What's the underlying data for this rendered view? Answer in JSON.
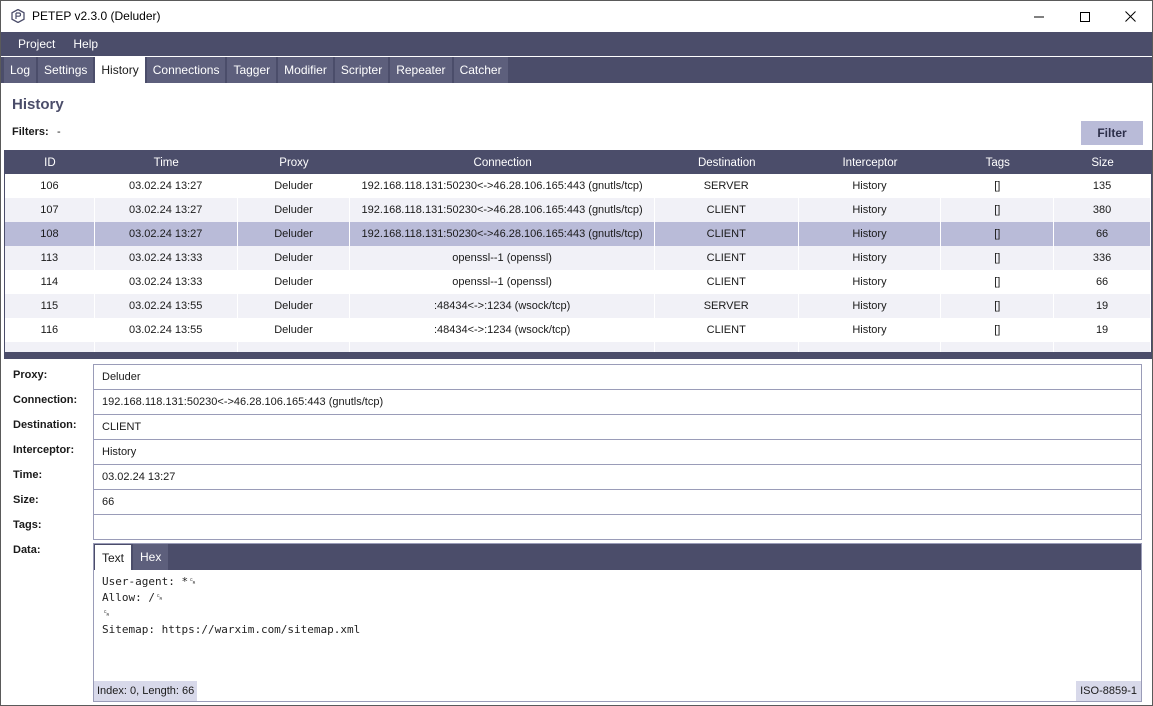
{
  "window": {
    "title": "PETEP v2.3.0 (Deluder)"
  },
  "menu": [
    "Project",
    "Help"
  ],
  "tabs": [
    "Log",
    "Settings",
    "History",
    "Connections",
    "Tagger",
    "Modifier",
    "Scripter",
    "Repeater",
    "Catcher"
  ],
  "active_tab": "History",
  "history": {
    "title": "History",
    "filters_label": "Filters:",
    "filters_value": "-",
    "filter_button": "Filter"
  },
  "table": {
    "columns": [
      "ID",
      "Time",
      "Proxy",
      "Connection",
      "Destination",
      "Interceptor",
      "Tags",
      "Size"
    ],
    "rows": [
      [
        "106",
        "03.02.24 13:27",
        "Deluder",
        "192.168.118.131:50230<->46.28.106.165:443 (gnutls/tcp)",
        "SERVER",
        "History",
        "[]",
        "135"
      ],
      [
        "107",
        "03.02.24 13:27",
        "Deluder",
        "192.168.118.131:50230<->46.28.106.165:443 (gnutls/tcp)",
        "CLIENT",
        "History",
        "[]",
        "380"
      ],
      [
        "108",
        "03.02.24 13:27",
        "Deluder",
        "192.168.118.131:50230<->46.28.106.165:443 (gnutls/tcp)",
        "CLIENT",
        "History",
        "[]",
        "66"
      ],
      [
        "113",
        "03.02.24 13:33",
        "Deluder",
        "openssl--1 (openssl)",
        "CLIENT",
        "History",
        "[]",
        "336"
      ],
      [
        "114",
        "03.02.24 13:33",
        "Deluder",
        "openssl--1 (openssl)",
        "CLIENT",
        "History",
        "[]",
        "66"
      ],
      [
        "115",
        "03.02.24 13:55",
        "Deluder",
        ":48434<->:1234 (wsock/tcp)",
        "SERVER",
        "History",
        "[]",
        "19"
      ],
      [
        "116",
        "03.02.24 13:55",
        "Deluder",
        ":48434<->:1234 (wsock/tcp)",
        "CLIENT",
        "History",
        "[]",
        "19"
      ]
    ],
    "selected_row": 2
  },
  "detail": {
    "proxy_label": "Proxy:",
    "proxy": "Deluder",
    "connection_label": "Connection:",
    "connection": "192.168.118.131:50230<->46.28.106.165:443 (gnutls/tcp)",
    "destination_label": "Destination:",
    "destination": "CLIENT",
    "interceptor_label": "Interceptor:",
    "interceptor": "History",
    "time_label": "Time:",
    "time": "03.02.24 13:27",
    "size_label": "Size:",
    "size": "66",
    "tags_label": "Tags:",
    "tags": "",
    "data_label": "Data:"
  },
  "data": {
    "tabs": [
      "Text",
      "Hex"
    ],
    "active": "Text",
    "content": "User-agent: *␍\nAllow: /␍\n␍\nSitemap: https://warxim.com/sitemap.xml",
    "status": "Index: 0, Length: 66",
    "charset": "ISO-8859-1"
  },
  "colors": {
    "accent": "#4b4d6a",
    "selected": "#b9bbd8"
  }
}
